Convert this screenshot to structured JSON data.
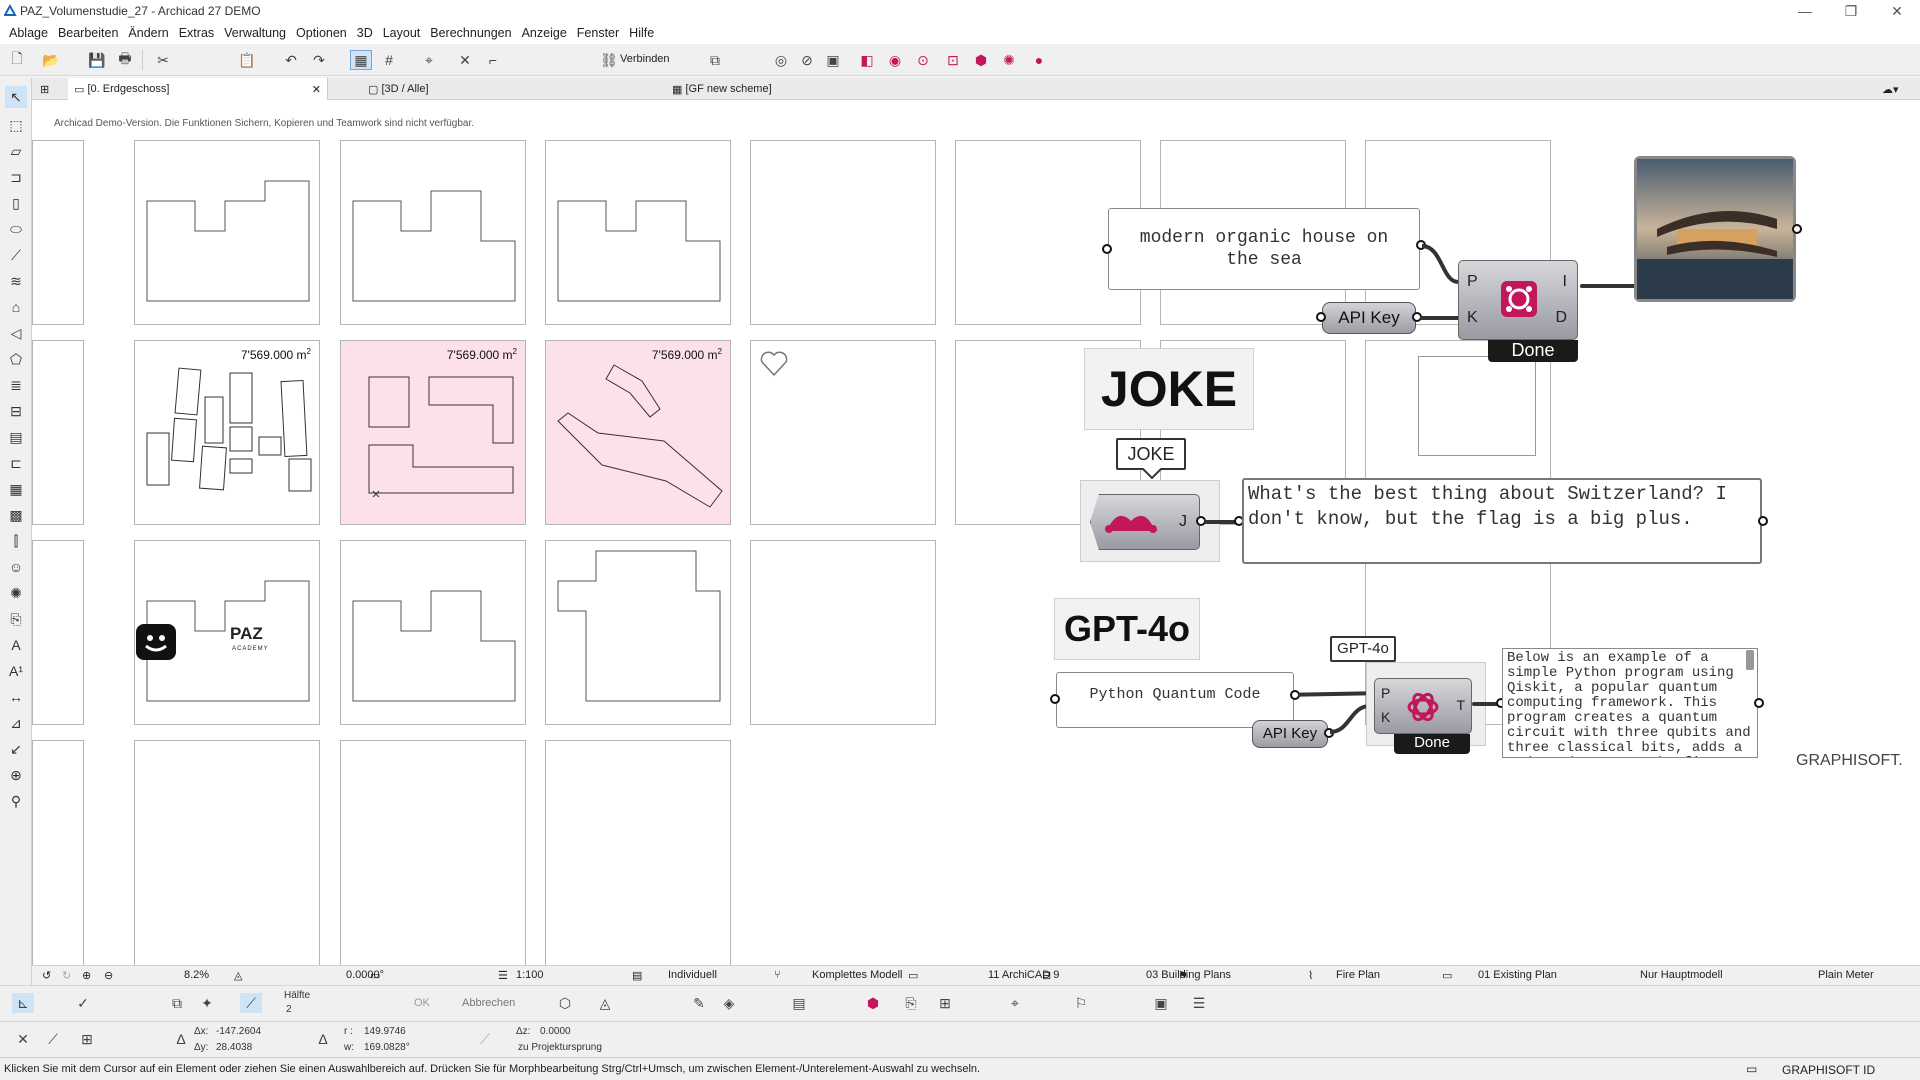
{
  "window": {
    "title": "PAZ_Volumenstudie_27 - Archicad 27 DEMO"
  },
  "menu": [
    "Ablage",
    "Bearbeiten",
    "Ändern",
    "Extras",
    "Verwaltung",
    "Optionen",
    "3D",
    "Layout",
    "Berechnungen",
    "Anzeige",
    "Fenster",
    "Hilfe"
  ],
  "toolbar": {
    "connect_label": "Verbinden"
  },
  "tabs": {
    "floor": "[0. Erdgeschoss]",
    "view3d": "[3D / Alle]",
    "scheme": "[GF new scheme]"
  },
  "notice": "Archicad Demo-Version. Die Funktionen Sichern, Kopieren und Teamwork sind nicht verfügbar.",
  "plans": {
    "area_1": "7'569.000 m",
    "area_2": "7'569.000 m",
    "area_3": "7'569.000 m",
    "area_sup": "2"
  },
  "logo": {
    "brand": "PAZ",
    "sub": "ACADEMY"
  },
  "grasshopper": {
    "prompt_text": "modern organic house on the sea",
    "api_key": "API Key",
    "node1_inputs": [
      "P",
      "K"
    ],
    "node1_outputs": [
      "I",
      "D"
    ],
    "done": "Done",
    "joke_card": "JOKE",
    "joke_bubble": "JOKE",
    "joke_output_label": "J",
    "joke_text": "What's the best thing about Switzerland? I don't know, but the flag is a big plus.",
    "gpt_card": "GPT-4o",
    "gpt_bubble": "GPT-4o",
    "python_prompt": "Python Quantum Code",
    "api_key_2": "API Key",
    "node3_inputs": [
      "P",
      "K"
    ],
    "node3_output": "T",
    "done_2": "Done",
    "python_output": "Below is an example of a simple Python program using Qiskit, a popular quantum computing framework. This program creates a quantum circuit with three qubits and three classical bits, adds a Hadamard gate to the first",
    "watermark": "GRAPHISOFT."
  },
  "navbar": {
    "zoom": "8.2%",
    "angle": "0.0000°",
    "scale": "1:100",
    "layer_combo": "Individuell",
    "model_view": "Komplettes Modell",
    "pen_set": "11 ArchiCAD 9",
    "layer_set": "03 Building Plans",
    "mvo": "Fire Plan",
    "renovation": "01 Existing Plan",
    "structure": "Nur Hauptmodell",
    "dimension": "Plain Meter"
  },
  "infobox": {
    "half_label": "Hälfte",
    "half_value": "2",
    "ok": "OK",
    "cancel": "Abbrechen",
    "dx": "-147.2604",
    "dy": "28.4038",
    "r": "149.9746",
    "w": "169.0828°",
    "dz": "0.0000",
    "dz_ref": "zu Projektursprung"
  },
  "status": {
    "hint": "Klicken Sie mit dem Cursor auf ein Element oder ziehen Sie einen Auswahlbereich auf. Drücken Sie für Morphbearbeitung Strg/Ctrl+Umsch, um zwischen Element-/Unterelement-Auswahl zu wechseln.",
    "brand": "GRAPHISOFT ID"
  },
  "colors": {
    "pink_panel": "#fde1e8",
    "magenta_icon": "#c2185b"
  }
}
